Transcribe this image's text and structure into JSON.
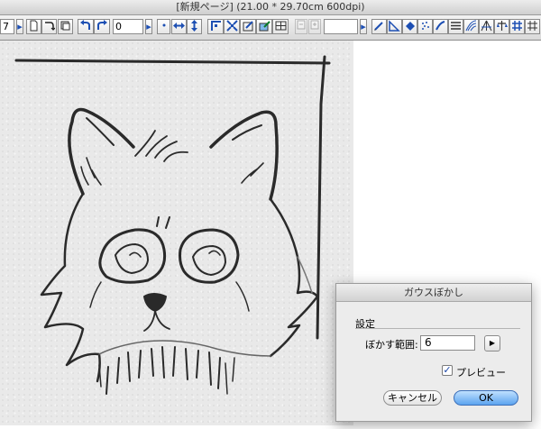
{
  "window": {
    "title": "[新規ページ] (21.00 * 29.70cm 600dpi)"
  },
  "toolbar": {
    "left_field_value": "7",
    "rotation_value": "0",
    "page_field_value": "",
    "icons": [
      "page-icon",
      "page-curl-icon",
      "layer-icon",
      "undo-icon",
      "redo-icon",
      "dot-icon",
      "horizontal-arrows-icon",
      "vertical-arrows-icon",
      "corner-icon",
      "shrink-icon",
      "transform-icon",
      "pick-color-icon",
      "grid-icon",
      "prev-page-icon",
      "next-page-icon",
      "pencil-icon",
      "ruler-icon",
      "fill-icon",
      "spray-icon",
      "brush-icon",
      "lines-icon",
      "hatch-icon",
      "perspective-icon",
      "balance-icon",
      "grid-tool-icon"
    ]
  },
  "dialog": {
    "title": "ガウスぼかし",
    "section": "設定",
    "radius_label": "ぼかす範囲:",
    "radius_value": "6",
    "preview_label": "プレビュー",
    "preview_checked": true,
    "check_mark": "✓",
    "stepper_arrow": "▶",
    "cancel_label": "キャンセル",
    "ok_label": "OK"
  }
}
